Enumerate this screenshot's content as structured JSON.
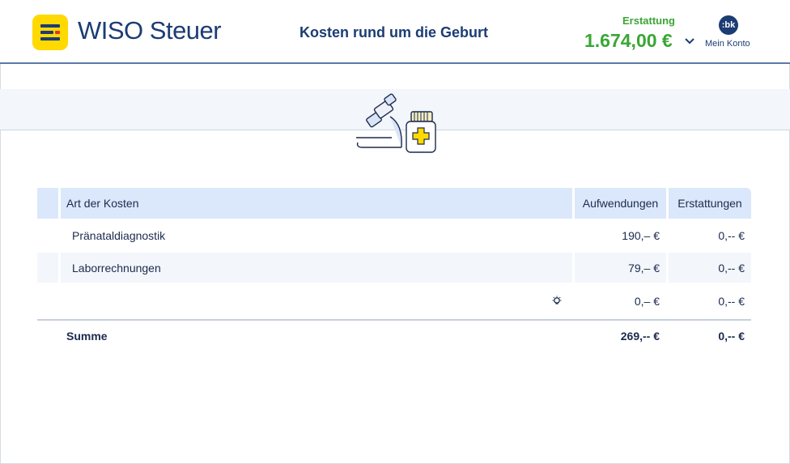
{
  "header": {
    "logo_text": "WISO Steuer",
    "page_title": "Kosten rund um die Geburt",
    "refund_label": "Erstattung",
    "refund_value": "1.674,00 €",
    "account_initials": ":bk",
    "account_label": "Mein Konto"
  },
  "table": {
    "columns": [
      "Art der Kosten",
      "Aufwendungen",
      "Erstattungen"
    ],
    "rows": [
      {
        "label": "Pränataldiagnostik",
        "expenses": "190,– €",
        "refunds": "0,-- €"
      },
      {
        "label": "Laborrechnungen",
        "expenses": "79,– €",
        "refunds": "0,-- €"
      },
      {
        "label": "",
        "expenses": "0,– €",
        "refunds": "0,-- €"
      }
    ],
    "sum": {
      "label": "Summe",
      "expenses": "269,-- €",
      "refunds": "0,-- €"
    }
  },
  "colors": {
    "brand_blue": "#1b3c74",
    "brand_yellow": "#ffd900",
    "refund_green": "#3aa635",
    "header_cell": "#dbe8fb"
  },
  "icons": [
    "wiso-logo-icon",
    "chevron-down-icon",
    "microscope-icon",
    "medicine-bottle-icon",
    "lightbulb-icon"
  ]
}
